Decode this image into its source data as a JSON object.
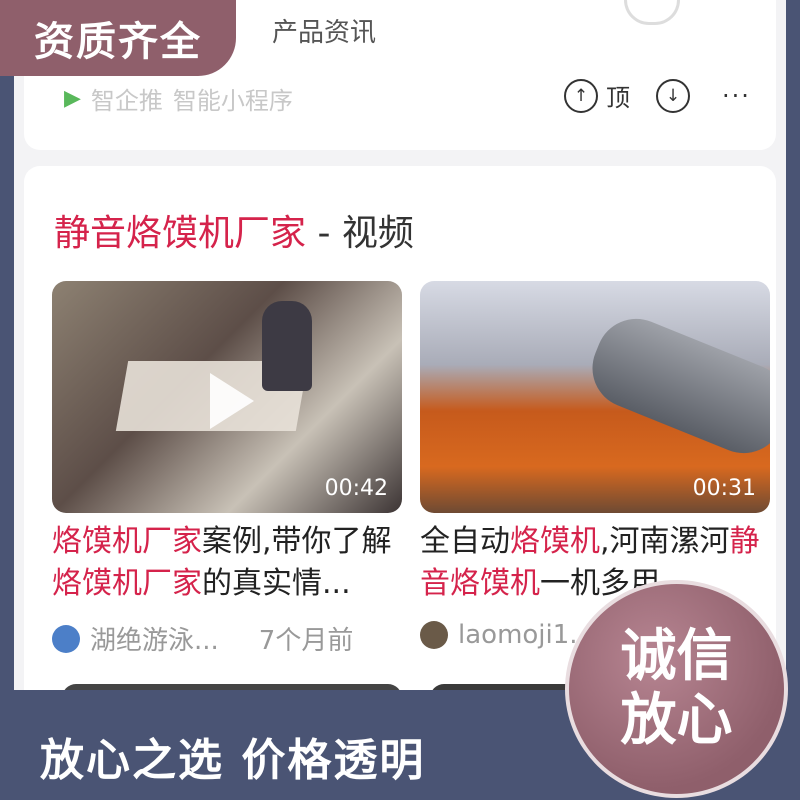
{
  "badges": {
    "top_left": "资质齐全",
    "seal_line1": "诚信",
    "seal_line2": "放心",
    "bottom": "放心之选   价格透明"
  },
  "top_card": {
    "snippet": "产品资讯",
    "mini_program": {
      "source": "智企推",
      "label": "智能小程序"
    },
    "actions": {
      "up_label": "顶"
    }
  },
  "section": {
    "title_keyword": "静音烙馍机厂家",
    "title_suffix": " - 视频"
  },
  "videos": [
    {
      "duration": "00:42",
      "title_hl1": "烙馍机厂家",
      "title_p1": "案例,带你了解",
      "title_hl2": "烙馍机厂家",
      "title_p2": "的真实情...",
      "author": "湖绝游泳...",
      "time": "7个月前"
    },
    {
      "duration": "00:31",
      "title_p0": "全自动",
      "title_hl1": "烙馍机",
      "title_p1": ",河南漯河",
      "title_hl2": "静音烙馍机",
      "title_p2": "一机多用...",
      "author": "laomoji1..."
    }
  ],
  "colors": {
    "accent": "#d5234b",
    "frame": "#4a5474",
    "badge": "#8f5f6b"
  }
}
